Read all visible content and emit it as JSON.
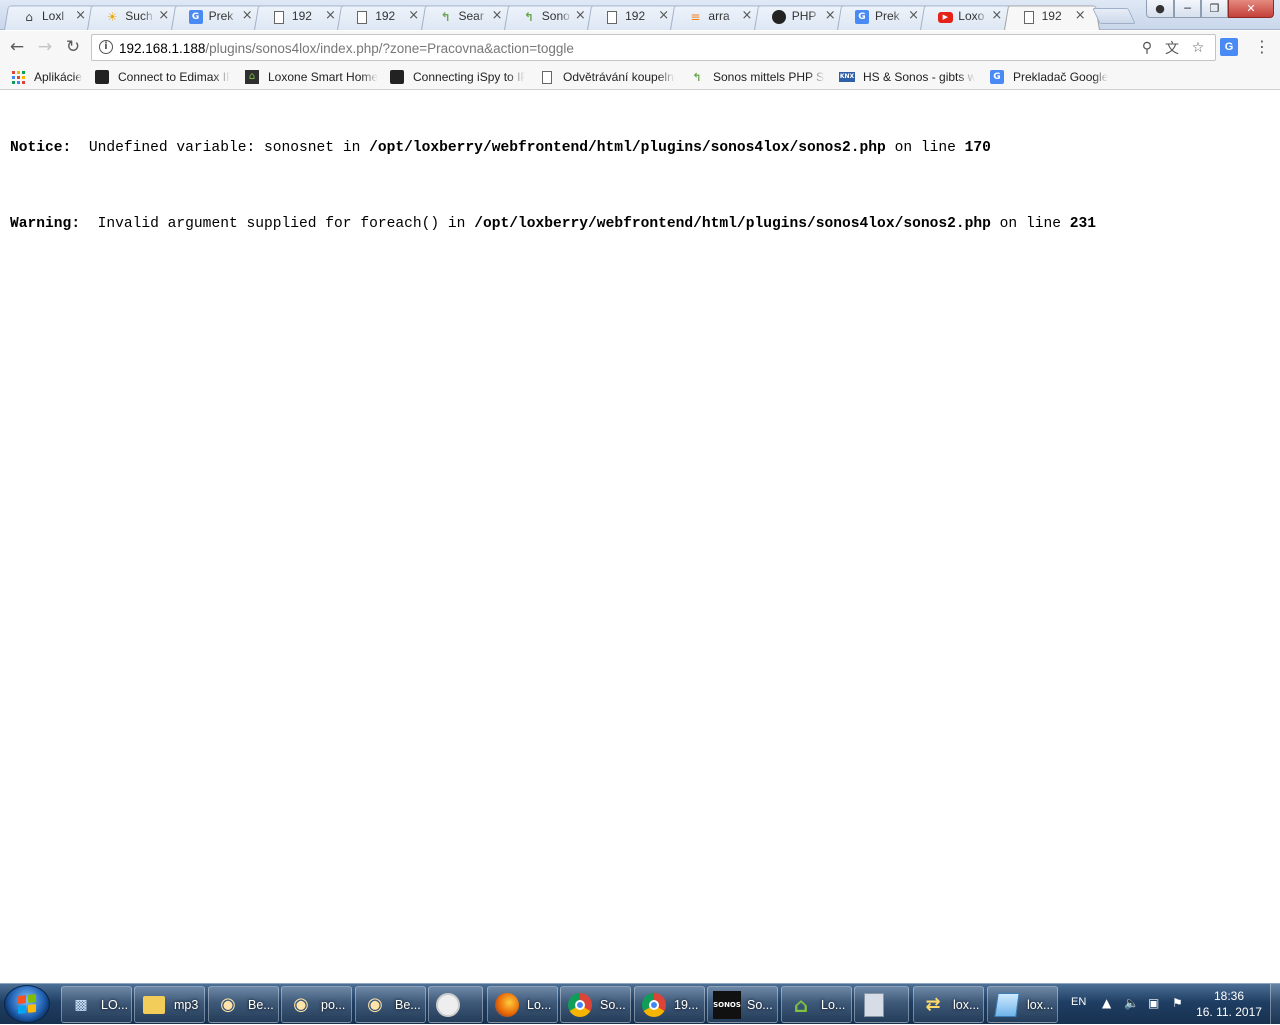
{
  "browser": {
    "tabs": [
      {
        "title": "Loxl",
        "icon": "house-icon",
        "active": false
      },
      {
        "title": "Such",
        "icon": "sun-icon",
        "active": false
      },
      {
        "title": "Prek",
        "icon": "google-translate-icon",
        "active": false
      },
      {
        "title": "192",
        "icon": "page-icon",
        "active": false
      },
      {
        "title": "192",
        "icon": "page-icon",
        "active": false
      },
      {
        "title": "Sear",
        "icon": "loxforum-icon",
        "active": false
      },
      {
        "title": "Sono",
        "icon": "loxforum-icon",
        "active": false
      },
      {
        "title": "192",
        "icon": "page-icon",
        "active": false
      },
      {
        "title": "arra",
        "icon": "stackoverflow-icon",
        "active": false
      },
      {
        "title": "PHP",
        "icon": "github-icon",
        "active": false
      },
      {
        "title": "Prek",
        "icon": "google-translate-icon",
        "active": false
      },
      {
        "title": "Loxo",
        "icon": "youtube-icon",
        "active": false
      },
      {
        "title": "192",
        "icon": "page-icon",
        "active": true
      }
    ],
    "address": {
      "host": "192.168.1.188",
      "path": "/plugins/sonos4lox/index.php/?zone=Pracovna&action=toggle"
    },
    "bookmarks": [
      {
        "label": "Aplikácie",
        "icon": "apps-grid-icon"
      },
      {
        "label": "Connect to Edimax IP",
        "icon": "camera-icon"
      },
      {
        "label": "Loxone Smart Home",
        "icon": "loxone-icon"
      },
      {
        "label": "Connecting iSpy to IP",
        "icon": "camera-icon"
      },
      {
        "label": "Odvětrávání koupelny",
        "icon": "page-icon"
      },
      {
        "label": "Sonos mittels PHP Sk",
        "icon": "loxforum-icon"
      },
      {
        "label": "HS & Sonos - gibts w",
        "icon": "knx-icon"
      },
      {
        "label": "Prekladač Google",
        "icon": "google-translate-icon"
      }
    ]
  },
  "page": {
    "messages": [
      {
        "level": "Notice",
        "text": "Undefined variable: sonosnet",
        "in": "in",
        "file": "/opt/loxberry/webfrontend/html/plugins/sonos4lox/sonos2.php",
        "on_line": "on line",
        "line": "170"
      },
      {
        "level": "Warning",
        "text": "Invalid argument supplied for foreach()",
        "in": "in",
        "file": "/opt/loxberry/webfrontend/html/plugins/sonos4lox/sonos2.php",
        "on_line": "on line",
        "line": "231"
      }
    ]
  },
  "taskbar": {
    "items": [
      {
        "label": "LO...",
        "icon": "computer-icon"
      },
      {
        "label": "mp3",
        "icon": "folder-icon"
      },
      {
        "label": "Be...",
        "icon": "paint-icon"
      },
      {
        "label": "po...",
        "icon": "paint-icon"
      },
      {
        "label": "Be...",
        "icon": "paint-icon"
      },
      {
        "label": "",
        "icon": "clock-app-icon"
      },
      {
        "label": "Lo...",
        "icon": "firefox-icon"
      },
      {
        "label": "So...",
        "icon": "chrome-icon"
      },
      {
        "label": "19...",
        "icon": "chrome-icon"
      },
      {
        "label": "So...",
        "icon": "sonos-icon"
      },
      {
        "label": "Lo...",
        "icon": "loxone-house-icon"
      },
      {
        "label": "",
        "icon": "calculator-icon"
      },
      {
        "label": "lox...",
        "icon": "network-icon"
      },
      {
        "label": "lox...",
        "icon": "notepad-icon"
      }
    ],
    "sonos_icon_text": "SONOS",
    "tray": {
      "language": "EN",
      "time": "18:36",
      "date": "16. 11. 2017"
    }
  },
  "colors": {
    "taskbar": "#1f3e63",
    "omnibox_host": "#000000",
    "omnibox_path": "#777777",
    "window_close": "#c4403a"
  }
}
